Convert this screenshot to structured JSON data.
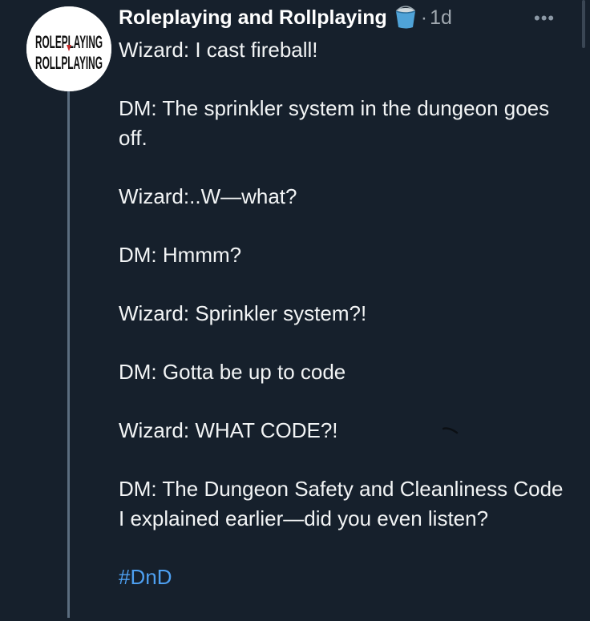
{
  "post": {
    "author": "Roleplaying and Rollplaying",
    "separator": "·",
    "time": "1d",
    "avatar_text_top": "ROLEPLAYING",
    "avatar_text_bottom": "ROLLPLAYING",
    "author_emoji": "bucket-icon",
    "paragraphs": [
      "Wizard: I cast fireball!",
      "DM: The sprinkler system in the dungeon goes off.",
      "Wizard:..W—what?",
      "DM: Hmmm?",
      "Wizard: Sprinkler system?!",
      "DM: Gotta be up to code",
      "Wizard: WHAT CODE?!",
      "DM: The Dungeon Safety and Cleanliness Code I explained earlier—did you even listen?"
    ],
    "hashtag": "#DnD",
    "more": "•••"
  },
  "colors": {
    "background": "#16202c",
    "text": "#f2f4f5",
    "muted": "#a0a8b0",
    "link": "#4d9ff0",
    "thread": "#5b6d7f"
  }
}
